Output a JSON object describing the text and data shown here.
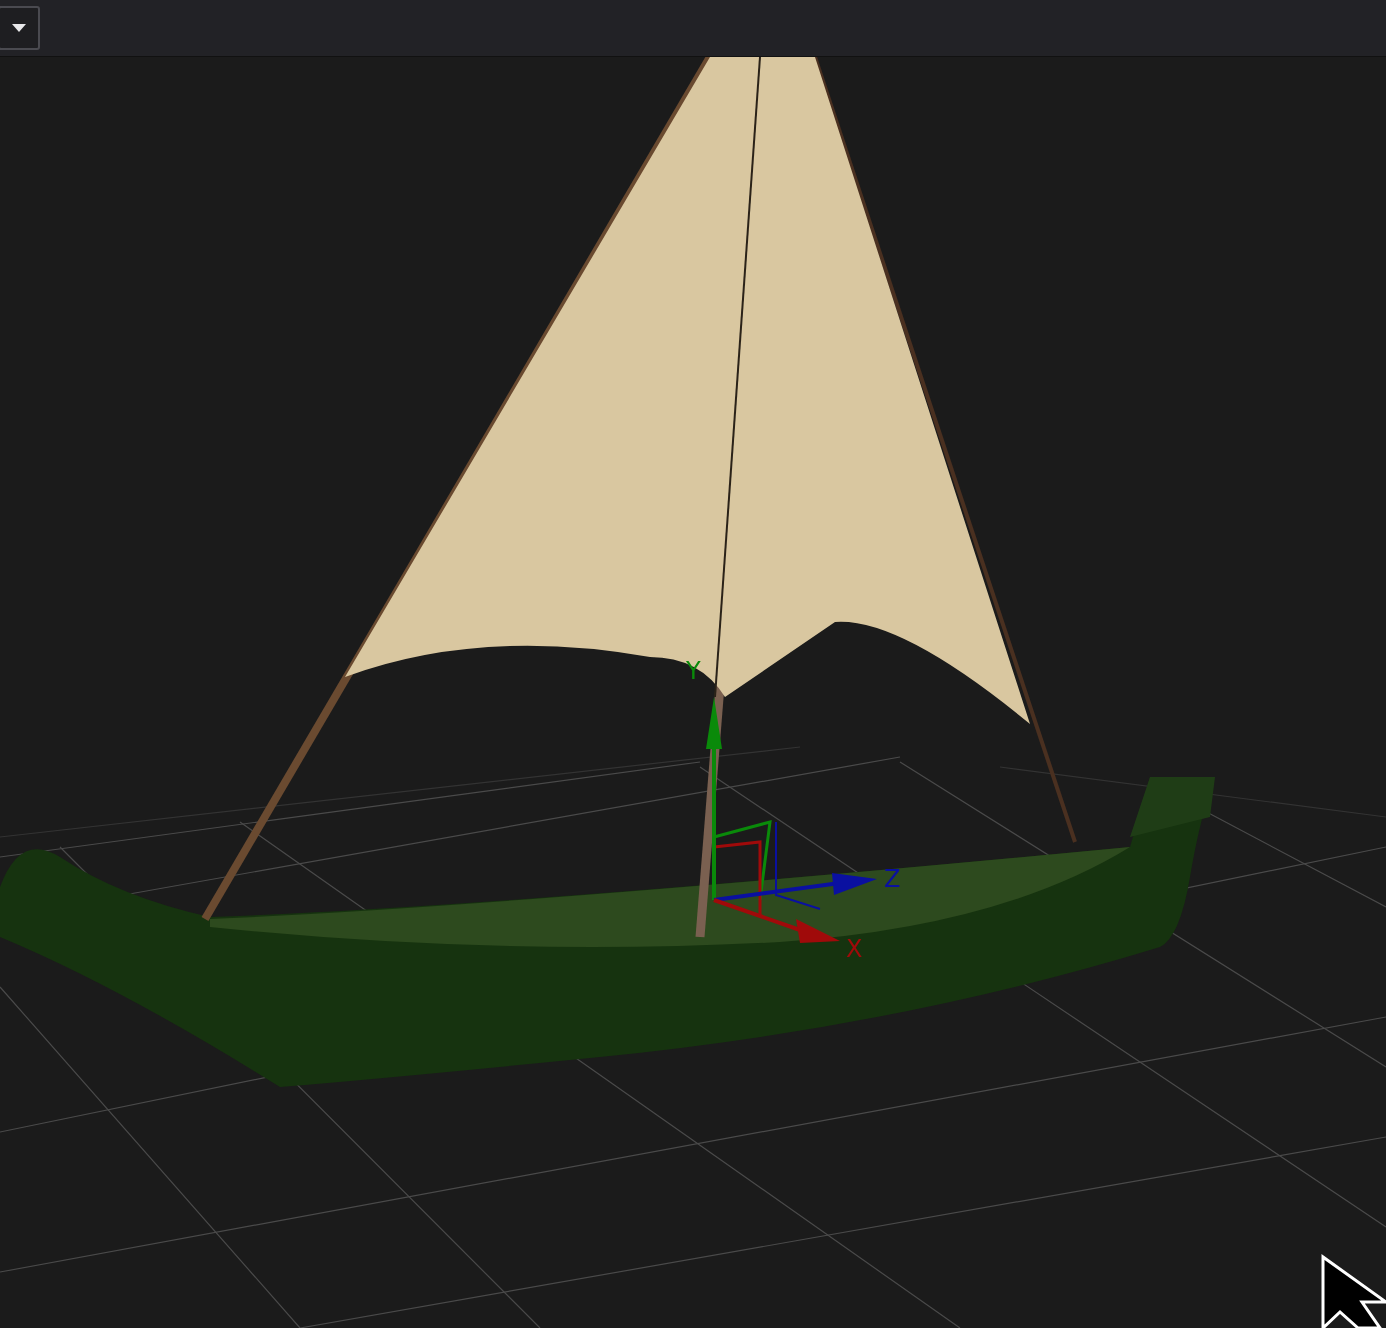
{
  "viewport": {
    "gizmo": {
      "axes": [
        {
          "label": "Y",
          "color": "#0a8a0a",
          "kind": "y"
        },
        {
          "label": "Z",
          "color": "#0a10a0",
          "kind": "z"
        },
        {
          "label": "X",
          "color": "#a00a0a",
          "kind": "x"
        }
      ]
    }
  }
}
